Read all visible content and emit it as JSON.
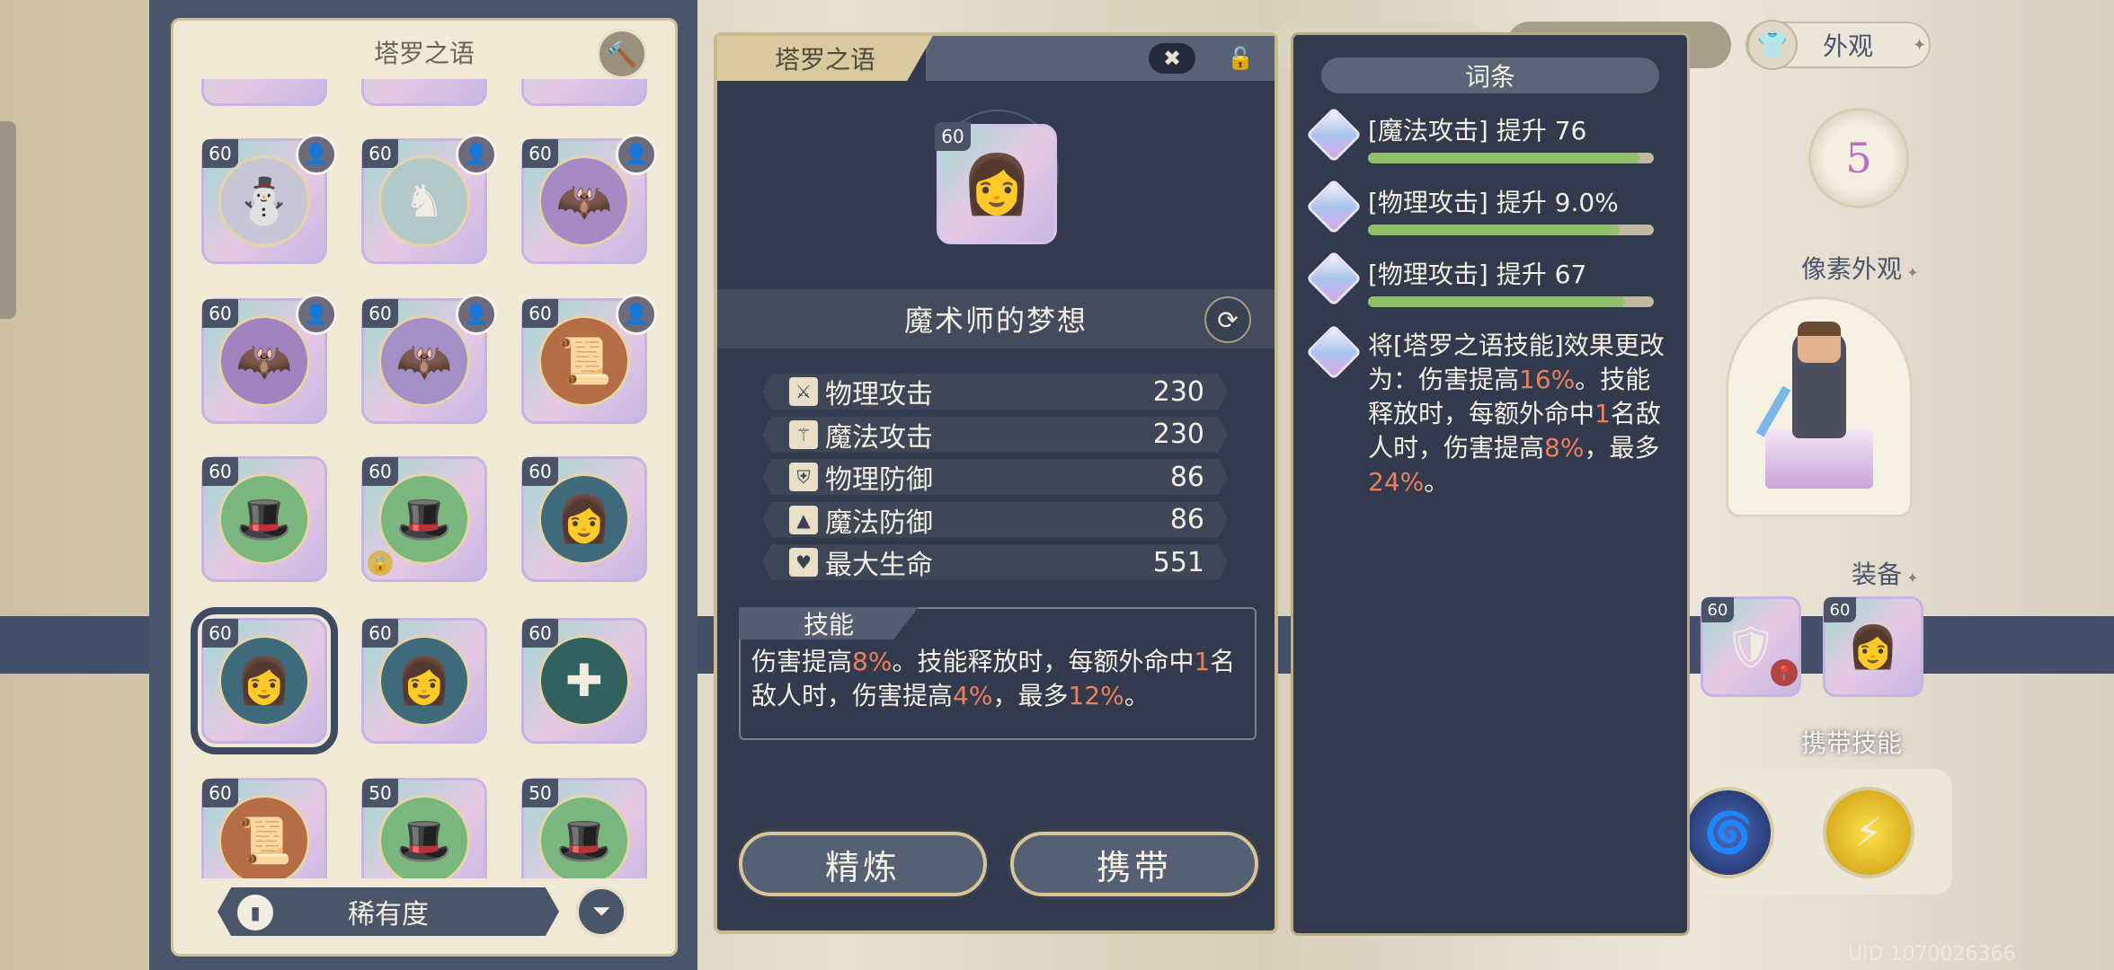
{
  "inventory": {
    "title": "塔罗之语",
    "hammer_icon": "hammer-icon",
    "items": [
      {
        "level": "60",
        "emblem": "⛄",
        "color": "#c7c5d6",
        "avatar": "👤"
      },
      {
        "level": "60",
        "emblem": "♞",
        "color": "#b3c8c9",
        "avatar": "👤"
      },
      {
        "level": "60",
        "emblem": "🦇",
        "color": "#a68ac4",
        "avatar": "👤"
      },
      {
        "level": "60",
        "emblem": "🦇",
        "color": "#9f84c0",
        "avatar": "👤"
      },
      {
        "level": "60",
        "emblem": "🦇",
        "color": "#a48fc6",
        "avatar": "👤"
      },
      {
        "level": "60",
        "emblem": "📜",
        "color": "#b56d45",
        "avatar": "👤"
      },
      {
        "level": "60",
        "emblem": "🎩",
        "color": "#79b77e"
      },
      {
        "level": "60",
        "emblem": "🎩",
        "color": "#79b77e",
        "locked": true
      },
      {
        "level": "60",
        "emblem": "👩",
        "color": "#3f6a7c"
      },
      {
        "level": "60",
        "emblem": "👩",
        "color": "#3f6a7c",
        "selected": true
      },
      {
        "level": "60",
        "emblem": "👩",
        "color": "#3f6a7c"
      },
      {
        "level": "60",
        "emblem": "✚",
        "color": "#33615f"
      },
      {
        "level": "60",
        "emblem": "📜",
        "color": "#b56d45"
      },
      {
        "level": "50",
        "emblem": "🎩",
        "color": "#79b77e"
      },
      {
        "level": "50",
        "emblem": "🎩",
        "color": "#79b77e"
      }
    ],
    "rarity_label": "稀有度"
  },
  "detail": {
    "tab_title": "塔罗之语",
    "item_level": "60",
    "item_name": "魔术师的梦想",
    "stats": [
      {
        "icon": "sword-icon",
        "glyph": "⚔",
        "label": "物理攻击",
        "value": "230"
      },
      {
        "icon": "wand-icon",
        "glyph": "⚚",
        "label": "魔法攻击",
        "value": "230"
      },
      {
        "icon": "shield-icon",
        "glyph": "⛨",
        "label": "物理防御",
        "value": "86"
      },
      {
        "icon": "wizard-hat-icon",
        "glyph": "▲",
        "label": "魔法防御",
        "value": "86"
      },
      {
        "icon": "heart-icon",
        "glyph": "♥",
        "label": "最大生命",
        "value": "551"
      }
    ],
    "skill_title": "技能",
    "skill_parts": [
      {
        "t": "伤害提高",
        "h": false
      },
      {
        "t": "8%",
        "h": true
      },
      {
        "t": "。技能释放时，每额外命中",
        "h": false
      },
      {
        "t": "1",
        "h": true
      },
      {
        "t": "名敌人时，伤害提高",
        "h": false
      },
      {
        "t": "4%",
        "h": true
      },
      {
        "t": "，最多",
        "h": false
      },
      {
        "t": "12%",
        "h": true
      },
      {
        "t": "。",
        "h": false
      }
    ],
    "refine_label": "精炼",
    "carry_label": "携带"
  },
  "affix": {
    "title": "词条",
    "lines": [
      {
        "text": "[魔法攻击] 提升 76",
        "fill": 0.95
      },
      {
        "text": "[物理攻击] 提升 9.0%",
        "fill": 0.88
      },
      {
        "text": "[物理攻击] 提升 67",
        "fill": 0.9
      }
    ],
    "special_parts": [
      {
        "t": "将[塔罗之语技能]效果更改为：伤害提高",
        "h": false
      },
      {
        "t": "16%",
        "h": true
      },
      {
        "t": "。技能释放时，每额外命中",
        "h": false
      },
      {
        "t": "1",
        "h": true
      },
      {
        "t": "名敌人时，伤害提高",
        "h": false
      },
      {
        "t": "8%",
        "h": true
      },
      {
        "t": "，最多",
        "h": false
      },
      {
        "t": "24%",
        "h": true
      },
      {
        "t": "。",
        "h": false
      }
    ]
  },
  "side": {
    "appearance_label": "外观",
    "level_badge": "5",
    "pixel_appearance_label": "像素外观",
    "equipment_label": "装备",
    "equip_levels": [
      "60",
      "60"
    ],
    "carry_skill_label": "携带技能",
    "uid": "UID 1070026366"
  }
}
